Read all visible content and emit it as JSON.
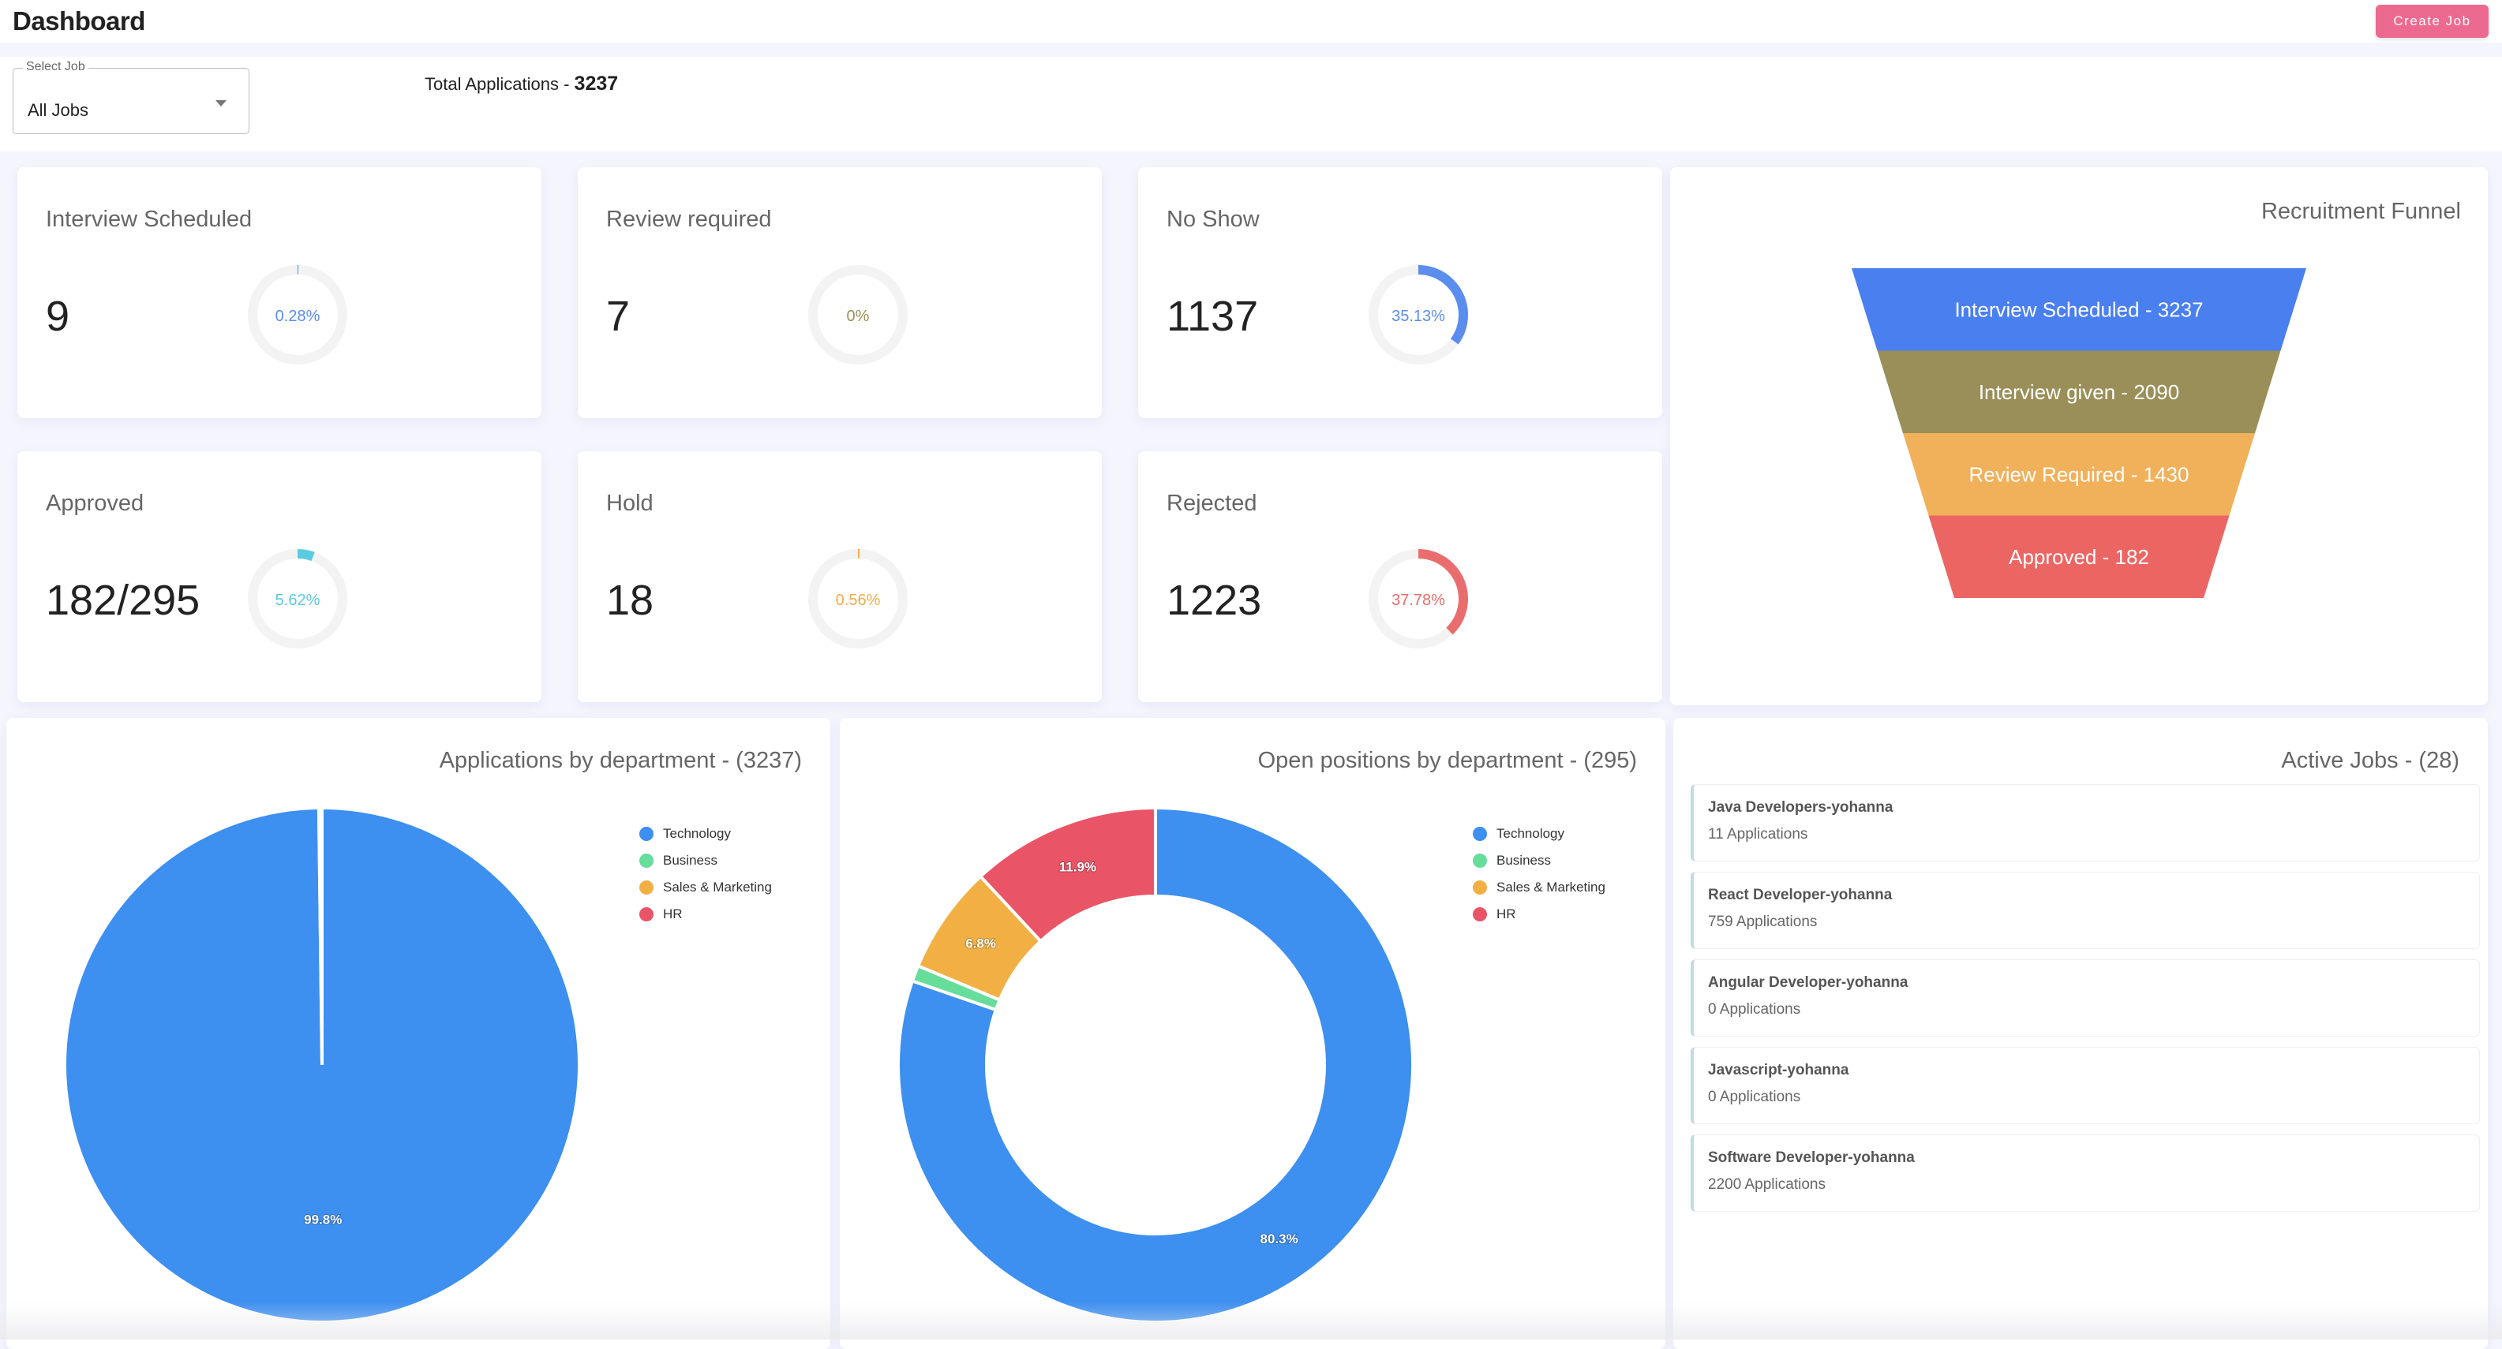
{
  "header": {
    "title": "Dashboard",
    "create_job_label": "Create Job"
  },
  "filter": {
    "select_label": "Select Job",
    "select_value": "All Jobs",
    "total_label": "Total Applications - ",
    "total_value": "3237"
  },
  "stats": [
    {
      "title": "Interview Scheduled",
      "value": "9",
      "percent_label": "0.28%",
      "percent": 0.28,
      "color": "#5b8def"
    },
    {
      "title": "Review required",
      "value": "7",
      "percent_label": "0%",
      "percent": 0,
      "color": "#9a8f55"
    },
    {
      "title": "No Show",
      "value": "1137",
      "percent_label": "35.13%",
      "percent": 35.13,
      "color": "#5b8def"
    },
    {
      "title": "Approved",
      "value": "182/295",
      "percent_label": "5.62%",
      "percent": 5.62,
      "color": "#5ccbe0"
    },
    {
      "title": "Hold",
      "value": "18",
      "percent_label": "0.56%",
      "percent": 0.56,
      "color": "#f0ad4e"
    },
    {
      "title": "Rejected",
      "value": "1223",
      "percent_label": "37.78%",
      "percent": 37.78,
      "color": "#ea6d6d"
    }
  ],
  "funnel": {
    "title": "Recruitment Funnel",
    "stages": [
      {
        "label": "Interview Scheduled - 3237",
        "value": 3237,
        "color": "#4a7ff0"
      },
      {
        "label": "Interview given - 2090",
        "value": 2090,
        "color": "#9a8f58"
      },
      {
        "label": "Review Required - 1430",
        "value": 1430,
        "color": "#f1b05a"
      },
      {
        "label": "Approved - 182",
        "value": 182,
        "color": "#eb6663"
      }
    ]
  },
  "chart_data": [
    {
      "type": "pie",
      "title": "Applications by department - (3237)",
      "categories": [
        "Technology",
        "Business",
        "Sales & Marketing",
        "HR"
      ],
      "values": [
        99.8,
        0.0,
        0.0,
        0.2
      ],
      "data_labels": [
        "99.8%",
        "",
        "",
        ""
      ],
      "colors": [
        "#3d8ff0",
        "#66dd9a",
        "#f2b044",
        "#e95566"
      ],
      "legend_position": "top-right"
    },
    {
      "type": "pie",
      "variant": "donut",
      "title": "Open positions by department - (295)",
      "categories": [
        "Technology",
        "Business",
        "Sales & Marketing",
        "HR"
      ],
      "values": [
        80.3,
        1.0,
        6.8,
        11.9
      ],
      "data_labels": [
        "80.3%",
        "",
        "6.8%",
        "11.9%"
      ],
      "colors": [
        "#3d8ff0",
        "#66dd9a",
        "#f2b044",
        "#e95566"
      ],
      "legend_position": "top-right"
    }
  ],
  "active_jobs": {
    "title": "Active Jobs - (28)",
    "items": [
      {
        "title": "Java Developers-yohanna",
        "count": "11 Applications"
      },
      {
        "title": "React Developer-yohanna",
        "count": "759 Applications"
      },
      {
        "title": "Angular Developer-yohanna",
        "count": "0 Applications"
      },
      {
        "title": "Javascript-yohanna",
        "count": "0 Applications"
      },
      {
        "title": "Software Developer-yohanna",
        "count": "2200 Applications"
      }
    ]
  }
}
